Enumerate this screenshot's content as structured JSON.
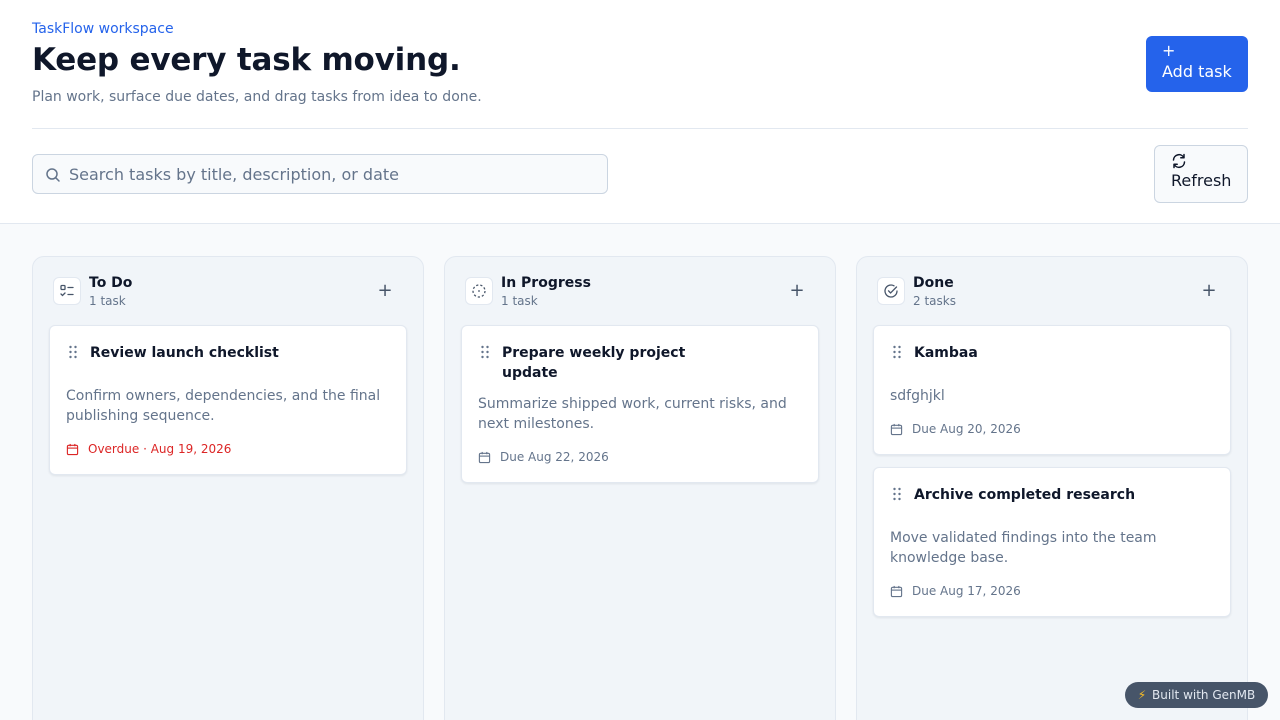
{
  "header": {
    "eyebrow": "TaskFlow workspace",
    "title": "Keep every task moving.",
    "subtitle": "Plan work, surface due dates, and drag tasks from idea to done.",
    "add_button": {
      "icon": "+",
      "label": "Add task"
    }
  },
  "search": {
    "placeholder": "Search tasks by title, description, or date",
    "value": ""
  },
  "refresh_button": {
    "label": "Refresh"
  },
  "columns": [
    {
      "title": "To Do",
      "count": "1 task",
      "icon": "list-checks-icon",
      "cards": [
        {
          "title": "Review launch checklist",
          "description": "Confirm owners, dependencies, and the final publishing sequence.",
          "due": "Overdue · Aug 19, 2026",
          "overdue": true
        }
      ]
    },
    {
      "title": "In Progress",
      "count": "1 task",
      "icon": "dashed-circle-icon",
      "cards": [
        {
          "title": "Prepare weekly project update",
          "description": "Summarize shipped work, current risks, and next milestones.",
          "due": "Due Aug 22, 2026",
          "overdue": false
        }
      ]
    },
    {
      "title": "Done",
      "count": "2 tasks",
      "icon": "check-circle-icon",
      "cards": [
        {
          "title": "Kambaa",
          "description": "sdfghjkl",
          "due": "Due Aug 20, 2026",
          "overdue": false
        },
        {
          "title": "Archive completed research",
          "description": "Move validated findings into the team knowledge base.",
          "due": "Due Aug 17, 2026",
          "overdue": false
        }
      ]
    }
  ],
  "column_add_icon": "+",
  "badge": {
    "icon": "⚡",
    "label": "Built with GenMB"
  },
  "colors": {
    "accent": "#2563eb",
    "overdue": "#dc2626",
    "muted": "#64748b"
  }
}
